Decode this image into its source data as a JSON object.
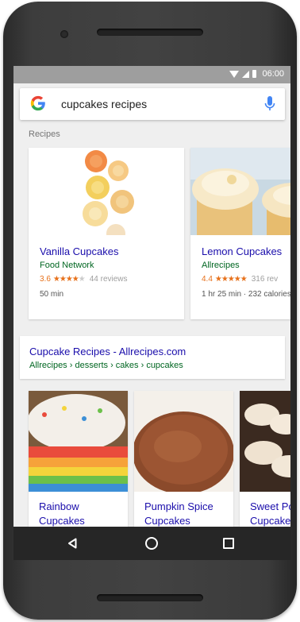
{
  "status_bar": {
    "time": "06:00"
  },
  "search": {
    "query": "cupcakes recipes"
  },
  "recipes_section": {
    "label": "Recipes",
    "cards": [
      {
        "title": "Vanilla Cupcakes",
        "source": "Food Network",
        "rating": "3.6",
        "stars": "★★★★",
        "empty_stars": "★",
        "reviews": "44 reviews",
        "meta": "50 min"
      },
      {
        "title": "Lemon Cupcakes",
        "source": "Allrecipes",
        "rating": "4.4",
        "stars": "★★★★★",
        "empty_stars": "",
        "reviews": "316 rev",
        "meta": "1 hr 25 min · 232 calories"
      }
    ]
  },
  "result": {
    "title": "Cupcake Recipes - Allrecipes.com",
    "url": "Allrecipes › desserts › cakes › cupcakes"
  },
  "recipe_carousel": {
    "cards": [
      {
        "title": "Rainbow Cupcakes"
      },
      {
        "title": "Pumpkin Spice Cupcakes"
      },
      {
        "title": "Sweet Potato Cupcakes"
      }
    ]
  },
  "colors": {
    "link_blue": "#1a0dab",
    "url_green": "#006621",
    "star_orange": "#e7711b",
    "status_bar_gray": "#9e9e9e",
    "nav_bar": "#262626"
  },
  "icons": {
    "status": [
      "wifi-icon",
      "signal-icon",
      "battery-icon"
    ],
    "search": [
      "google-logo-icon",
      "microphone-icon"
    ],
    "nav": [
      "back-icon",
      "home-icon",
      "recents-icon"
    ]
  }
}
